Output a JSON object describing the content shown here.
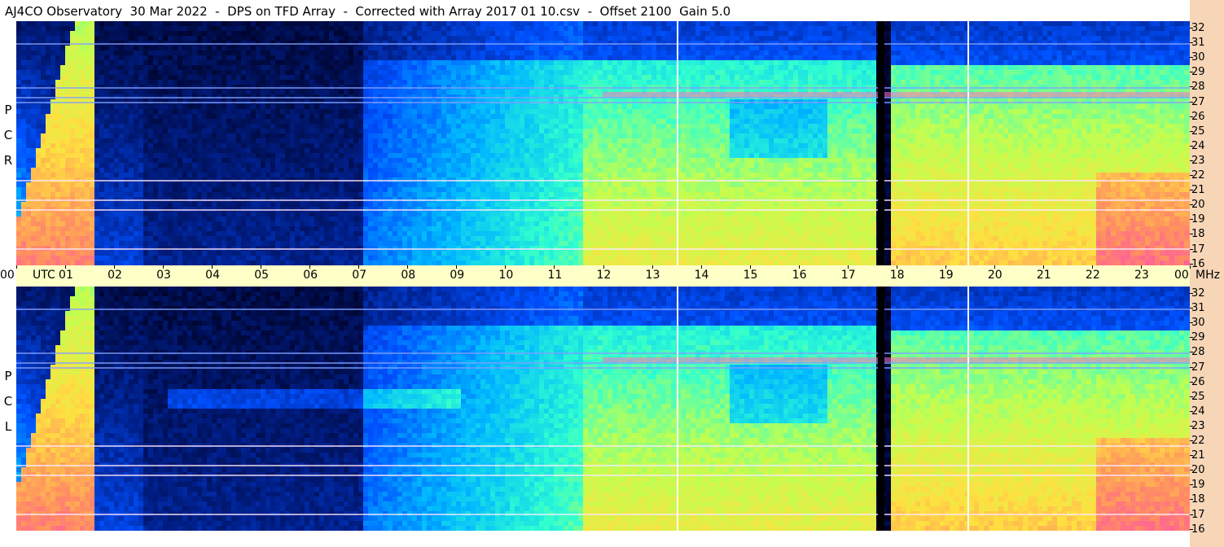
{
  "title": "AJ4CO Observatory  30 Mar 2022  -  DPS on TFD Array  -  Corrected with Array 2017 01 10.csv  -  Offset 2100  Gain 5.0",
  "panels": [
    {
      "id": "rcp",
      "label_letters": [
        "R",
        "C",
        "P"
      ]
    },
    {
      "id": "lcp",
      "label_letters": [
        "L",
        "C",
        "P"
      ]
    }
  ],
  "time_axis": {
    "labels": [
      "00",
      "01",
      "02",
      "03",
      "04",
      "05",
      "06",
      "07",
      "08",
      "09",
      "10",
      "11",
      "12",
      "13",
      "14",
      "15",
      "16",
      "17",
      "18",
      "19",
      "20",
      "21",
      "22",
      "23",
      "00"
    ],
    "unit_label": "UTC",
    "mhz_label": "MHz"
  },
  "freq_axis": {
    "ticks": [
      "32",
      "31",
      "30",
      "29",
      "28",
      "27",
      "26",
      "25",
      "24",
      "23",
      "22",
      "21",
      "20",
      "19",
      "18",
      "17",
      "16"
    ],
    "range": [
      16,
      32
    ]
  },
  "chart_data": {
    "type": "heatmap",
    "title": "AJ4CO Observatory  30 Mar 2022  -  DPS on TFD Array  -  Corrected with Array 2017 01 10.csv  -  Offset 2100  Gain 5.0",
    "x_unit": "UTC hour",
    "y_unit": "MHz",
    "xlim": [
      0,
      24
    ],
    "ylim": [
      16,
      32
    ],
    "series": [
      {
        "name": "RCP"
      },
      {
        "name": "LCP"
      }
    ],
    "colormap": [
      "#000020",
      "#00208c",
      "#0050ff",
      "#00b8ff",
      "#30ffd0",
      "#c0ff50",
      "#ffe040",
      "#ff9060",
      "#ff40c0",
      "#ffffff"
    ]
  }
}
